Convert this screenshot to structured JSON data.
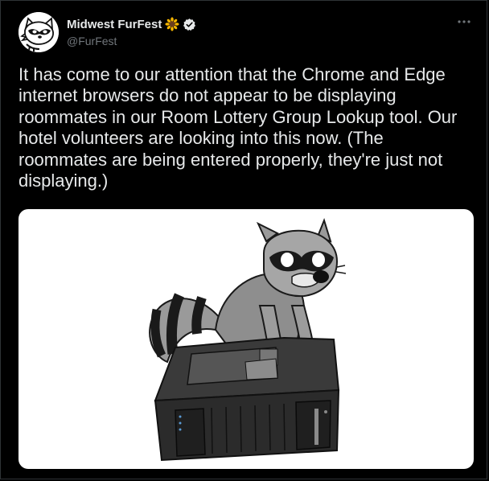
{
  "author": {
    "display_name": "Midwest FurFest",
    "handle": "@FurFest",
    "name_emoji": "sunflower-icon",
    "verified": true,
    "avatar": "raccoon-mascot-logo"
  },
  "tweet": {
    "text": "It has come to our attention that the Chrome and Edge internet browsers do not appear to be displaying roommates in our Room Lottery Group Lookup tool. Our hotel volunteers are looking into this now.  (The roommates are being entered properly, they're just not displaying.)",
    "media": {
      "description_icon": "raccoon-on-computer-illustration"
    }
  },
  "colors": {
    "background": "#000000",
    "text_primary": "#e7e9ea",
    "text_secondary": "#71767b",
    "verified_badge": "#e7e9ea",
    "sunflower": "#f4b400"
  }
}
